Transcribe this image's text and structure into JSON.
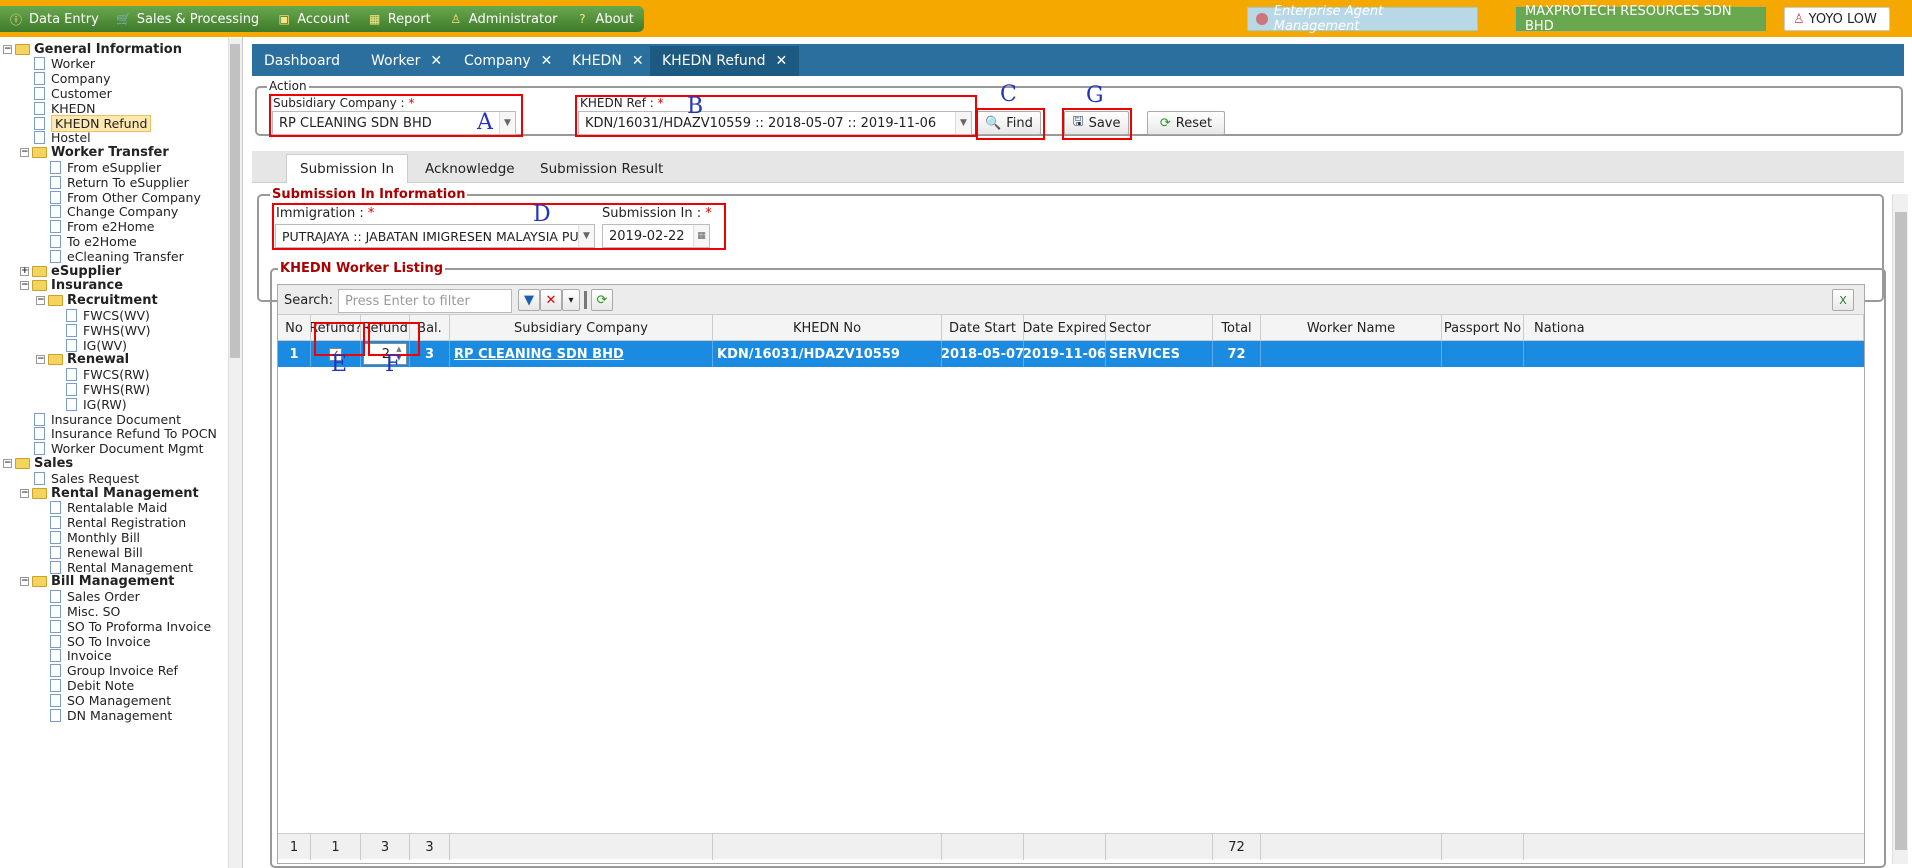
{
  "menu": {
    "items": [
      {
        "label": "Data Entry",
        "icon": "info-icon"
      },
      {
        "label": "Sales & Processing",
        "icon": "cart-icon"
      },
      {
        "label": "Account",
        "icon": "briefcase-icon"
      },
      {
        "label": "Report",
        "icon": "table-icon"
      },
      {
        "label": "Administrator",
        "icon": "admin-icon"
      },
      {
        "label": "About",
        "icon": "help-icon"
      }
    ]
  },
  "header": {
    "eam": "Enterprise Agent Management",
    "company": "MAXPROTECH RESOURCES SDN BHD",
    "user": "YOYO LOW"
  },
  "sidebar": {
    "nodes": [
      {
        "label": "General Information",
        "type": "folder",
        "level": 0,
        "exp": "−"
      },
      {
        "label": "Worker",
        "type": "doc",
        "level": 1
      },
      {
        "label": "Company",
        "type": "doc",
        "level": 1
      },
      {
        "label": "Customer",
        "type": "doc",
        "level": 1
      },
      {
        "label": "KHEDN",
        "type": "doc",
        "level": 1
      },
      {
        "label": "KHEDN Refund",
        "type": "doc",
        "level": 1,
        "selected": true
      },
      {
        "label": "Hostel",
        "type": "doc",
        "level": 1
      },
      {
        "label": "Worker Transfer",
        "type": "folder",
        "level": 1,
        "exp": "−"
      },
      {
        "label": "From eSupplier",
        "type": "doc",
        "level": 2
      },
      {
        "label": "Return To eSupplier",
        "type": "doc",
        "level": 2
      },
      {
        "label": "From Other Company",
        "type": "doc",
        "level": 2
      },
      {
        "label": "Change Company",
        "type": "doc",
        "level": 2
      },
      {
        "label": "From e2Home",
        "type": "doc",
        "level": 2
      },
      {
        "label": "To e2Home",
        "type": "doc",
        "level": 2
      },
      {
        "label": "eCleaning Transfer",
        "type": "doc",
        "level": 2
      },
      {
        "label": "eSupplier",
        "type": "folder",
        "level": 1,
        "exp": "+"
      },
      {
        "label": "Insurance",
        "type": "folder",
        "level": 1,
        "exp": "−"
      },
      {
        "label": "Recruitment",
        "type": "folder",
        "level": 2,
        "exp": "−"
      },
      {
        "label": "FWCS(WV)",
        "type": "doc",
        "level": 3
      },
      {
        "label": "FWHS(WV)",
        "type": "doc",
        "level": 3
      },
      {
        "label": "IG(WV)",
        "type": "doc",
        "level": 3
      },
      {
        "label": "Renewal",
        "type": "folder",
        "level": 2,
        "exp": "−"
      },
      {
        "label": "FWCS(RW)",
        "type": "doc",
        "level": 3
      },
      {
        "label": "FWHS(RW)",
        "type": "doc",
        "level": 3
      },
      {
        "label": "IG(RW)",
        "type": "doc",
        "level": 3
      },
      {
        "label": "Insurance Document",
        "type": "doc",
        "level": 1
      },
      {
        "label": "Insurance Refund To POCN",
        "type": "doc",
        "level": 1
      },
      {
        "label": "Worker Document Mgmt",
        "type": "doc",
        "level": 1
      },
      {
        "label": "Sales",
        "type": "folder",
        "level": 0,
        "exp": "−"
      },
      {
        "label": "Sales Request",
        "type": "doc",
        "level": 1
      },
      {
        "label": "Rental Management",
        "type": "folder",
        "level": 1,
        "exp": "−"
      },
      {
        "label": "Rentalable Maid",
        "type": "doc",
        "level": 2
      },
      {
        "label": "Rental Registration",
        "type": "doc",
        "level": 2
      },
      {
        "label": "Monthly Bill",
        "type": "doc",
        "level": 2
      },
      {
        "label": "Renewal Bill",
        "type": "doc",
        "level": 2
      },
      {
        "label": "Rental Management",
        "type": "doc",
        "level": 2
      },
      {
        "label": "Bill Management",
        "type": "folder",
        "level": 1,
        "exp": "−"
      },
      {
        "label": "Sales Order",
        "type": "doc",
        "level": 2
      },
      {
        "label": "Misc. SO",
        "type": "doc",
        "level": 2
      },
      {
        "label": "SO To Proforma Invoice",
        "type": "doc",
        "level": 2
      },
      {
        "label": "SO To Invoice",
        "type": "doc",
        "level": 2
      },
      {
        "label": "Invoice",
        "type": "doc",
        "level": 2
      },
      {
        "label": "Group Invoice Ref",
        "type": "doc",
        "level": 2
      },
      {
        "label": "Debit Note",
        "type": "doc",
        "level": 2
      },
      {
        "label": "SO Management",
        "type": "doc",
        "level": 2
      },
      {
        "label": "DN Management",
        "type": "doc",
        "level": 2
      }
    ]
  },
  "tabs": [
    {
      "label": "Dashboard",
      "closable": false
    },
    {
      "label": "Worker",
      "closable": true
    },
    {
      "label": "Company",
      "closable": true
    },
    {
      "label": "KHEDN",
      "closable": true
    },
    {
      "label": "KHEDN Refund",
      "closable": true,
      "active": true
    }
  ],
  "action": {
    "legend": "Action",
    "subsidiary_label": "Subsidiary Company :",
    "subsidiary_value": "RP CLEANING SDN BHD",
    "khedn_label": "KHEDN Ref :",
    "khedn_value": "KDN/16031/HDAZV10559 :: 2018-05-07 :: 2019-11-06",
    "find": "Find",
    "save": "Save",
    "reset": "Reset",
    "req": "*"
  },
  "subtabs": [
    "Submission In",
    "Acknowledge",
    "Submission Result"
  ],
  "submission": {
    "legend": "Submission In Information",
    "immigration_label": "Immigration :",
    "immigration_value": "PUTRAJAYA :: JABATAN IMIGRESEN MALAYSIA PUTRAJAYA",
    "date_label": "Submission In :",
    "date_value": "2019-02-22"
  },
  "listing": {
    "legend": "KHEDN Worker Listing",
    "search_label": "Search:",
    "search_placeholder": "Press Enter to filter",
    "columns": [
      "No",
      "Refund?",
      "Refund",
      "Bal.",
      "Subsidiary Company",
      "KHEDN No",
      "Date Start",
      "Date Expired",
      "Sector",
      "Total",
      "Worker Name",
      "Passport No",
      "Nationa"
    ],
    "row": {
      "no": "1",
      "refund_checked": "✓",
      "refund": "2",
      "bal": "3",
      "company": "RP CLEANING SDN BHD",
      "khedn": "KDN/16031/HDAZV10559",
      "start": "2018-05-07",
      "expired": "2019-11-06",
      "sector": "SERVICES",
      "total": "72"
    },
    "footer": {
      "count": "1",
      "refund_q": "1",
      "refund": "3",
      "bal": "3",
      "total": "72"
    }
  },
  "annotations": {
    "A": "A",
    "B": "B",
    "C": "C",
    "D": "D",
    "E": "E",
    "F": "F",
    "G": "G"
  }
}
